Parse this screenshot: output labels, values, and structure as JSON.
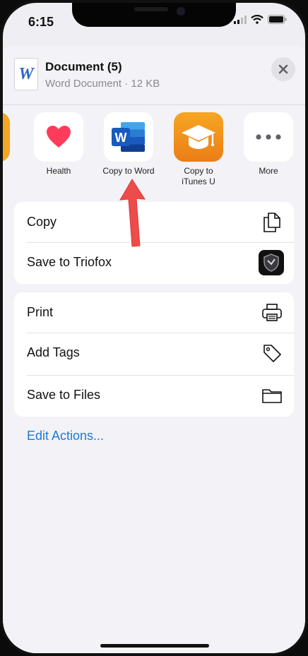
{
  "status": {
    "time": "6:15"
  },
  "header": {
    "doc_icon_letter": "W",
    "title": "Document (5)",
    "subtitle": "Word Document · 12 KB"
  },
  "apps": [
    {
      "label": "Health",
      "icon": "heart-icon"
    },
    {
      "label": "Copy to Word",
      "icon": "word-icon"
    },
    {
      "label": "Copy to\niTunes U",
      "icon": "itunes-u-icon"
    },
    {
      "label": "More",
      "icon": "more-icon"
    }
  ],
  "actions_group_1": [
    {
      "label": "Copy",
      "icon": "copy-icon"
    },
    {
      "label": "Save to Triofox",
      "icon": "triofox-icon"
    }
  ],
  "actions_group_2": [
    {
      "label": "Print",
      "icon": "printer-icon"
    },
    {
      "label": "Add Tags",
      "icon": "tag-icon"
    },
    {
      "label": "Save to Files",
      "icon": "folder-icon"
    }
  ],
  "edit_actions": "Edit Actions...",
  "colors": {
    "accent_blue": "#1d7ad7",
    "health_red": "#ff3b5c",
    "word_blue": "#2b63c6",
    "itunes_orange": "#f0901a",
    "arrow_red": "#ee4b4b"
  }
}
